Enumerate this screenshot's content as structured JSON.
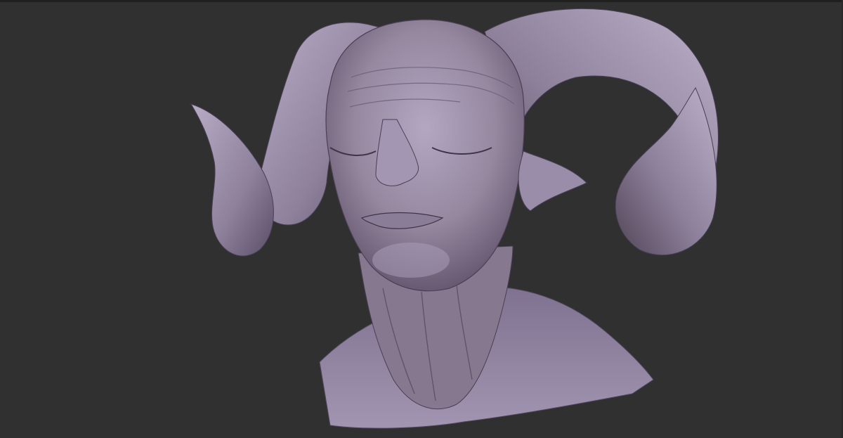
{
  "app": {
    "view": "3d-viewport",
    "subject": "sculpted-bust",
    "material_color": "#9c8fae",
    "highlight_color": "#c9bfd6",
    "shadow_color": "#3f3548",
    "background_color": "#303030"
  },
  "icons": {
    "model": "sculpt-model-icon"
  }
}
